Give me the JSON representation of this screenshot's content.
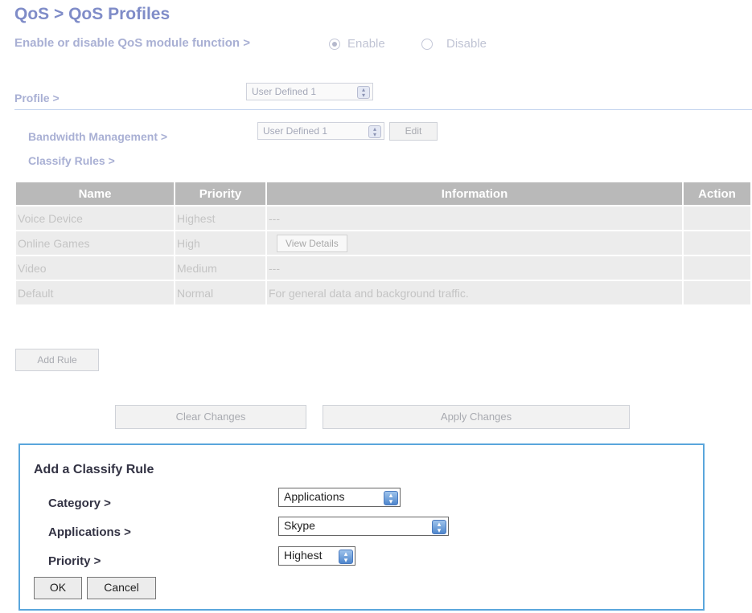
{
  "page": {
    "title": "QoS > QoS Profiles",
    "enable_label": "Enable or disable QoS module function >",
    "enable_option": "Enable",
    "disable_option": "Disable",
    "enabled": true
  },
  "profile": {
    "label": "Profile >",
    "selected": "User Defined 1"
  },
  "bandwidth": {
    "label": "Bandwidth Management >",
    "selected": "User Defined 1",
    "edit_label": "Edit"
  },
  "classify": {
    "label": "Classify Rules >",
    "columns": [
      "Name",
      "Priority",
      "Information",
      "Action"
    ],
    "rows": [
      {
        "name": "Voice Device",
        "priority": "Highest",
        "info": "---",
        "action": ""
      },
      {
        "name": "Online Games",
        "priority": "High",
        "info": "View Details",
        "action": ""
      },
      {
        "name": "Video",
        "priority": "Medium",
        "info": "---",
        "action": ""
      },
      {
        "name": "Default",
        "priority": "Normal",
        "info": "For general data and background traffic.",
        "action": ""
      }
    ],
    "add_rule_label": "Add Rule"
  },
  "actions": {
    "clear_label": "Clear Changes",
    "apply_label": "Apply Changes"
  },
  "dialog": {
    "title": "Add a Classify Rule",
    "category_label": "Category >",
    "category_value": "Applications",
    "applications_label": "Applications >",
    "applications_value": "Skype",
    "priority_label": "Priority >",
    "priority_value": "Highest",
    "ok_label": "OK",
    "cancel_label": "Cancel"
  },
  "colors": {
    "title": "#7f8cc8",
    "header_bg": "#b9b9b9",
    "panel_border": "#5aa6dc"
  }
}
